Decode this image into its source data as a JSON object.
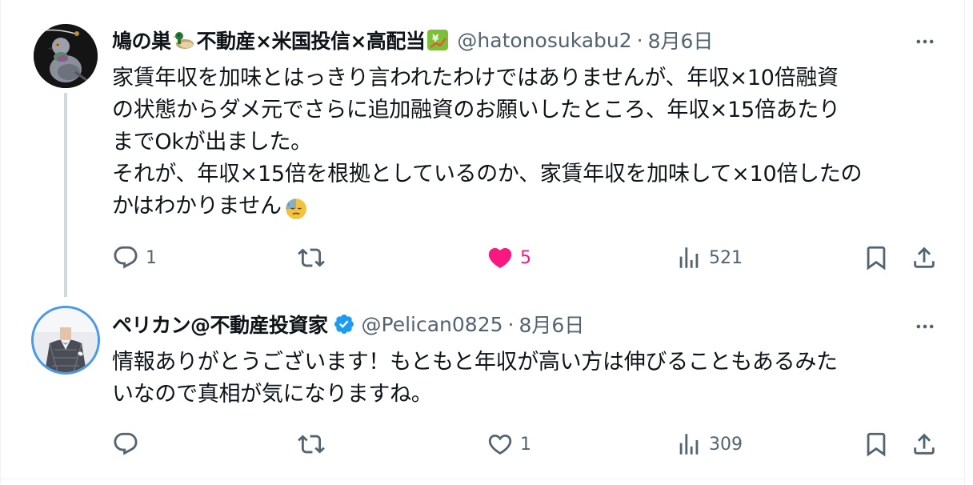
{
  "tweets": [
    {
      "author": {
        "name": "鳩の巣",
        "name_suffix": "不動産×米国投信×高配当",
        "handle": "@hatonosukabu2",
        "separator": "·",
        "date": "8月6日"
      },
      "body_lines": [
        "家賃年収を加味とはっきり言われたわけではありませんが、年収×10倍融資",
        "の状態からダメ元でさらに追加融資のお願いしたところ、年収×15倍あたり",
        "までOkが出ました。",
        "それが、年収×15倍を根拠としているのか、家賃年収を加味して×10倍したの",
        "かはわかりません"
      ],
      "emoji_end": "downcast-sweat-face-emoji",
      "stats": {
        "replies": "1",
        "retweets": "",
        "likes": "5",
        "views": "521"
      },
      "liked": true
    },
    {
      "author": {
        "name": "ペリカン@不動産投資家",
        "handle": "@Pelican0825",
        "separator": "·",
        "date": "8月6日",
        "verified": true
      },
      "body_lines": [
        "情報ありがとうございます！もともと年収が高い方は伸びることもあるみた",
        "いなので真相が気になりますね。"
      ],
      "stats": {
        "replies": "",
        "retweets": "",
        "likes": "1",
        "views": "309"
      },
      "liked": false
    }
  ],
  "colors": {
    "text": "#0f1419",
    "secondary": "#536471",
    "like": "#f91880",
    "verified": "#1d9bf0",
    "thread_line": "#cfd9de"
  },
  "icons": [
    "more-icon",
    "reply-icon",
    "retweet-icon",
    "like-icon",
    "views-icon",
    "bookmark-icon",
    "share-icon",
    "verified-badge-icon",
    "duck-emoji",
    "chart-yen-emoji"
  ]
}
